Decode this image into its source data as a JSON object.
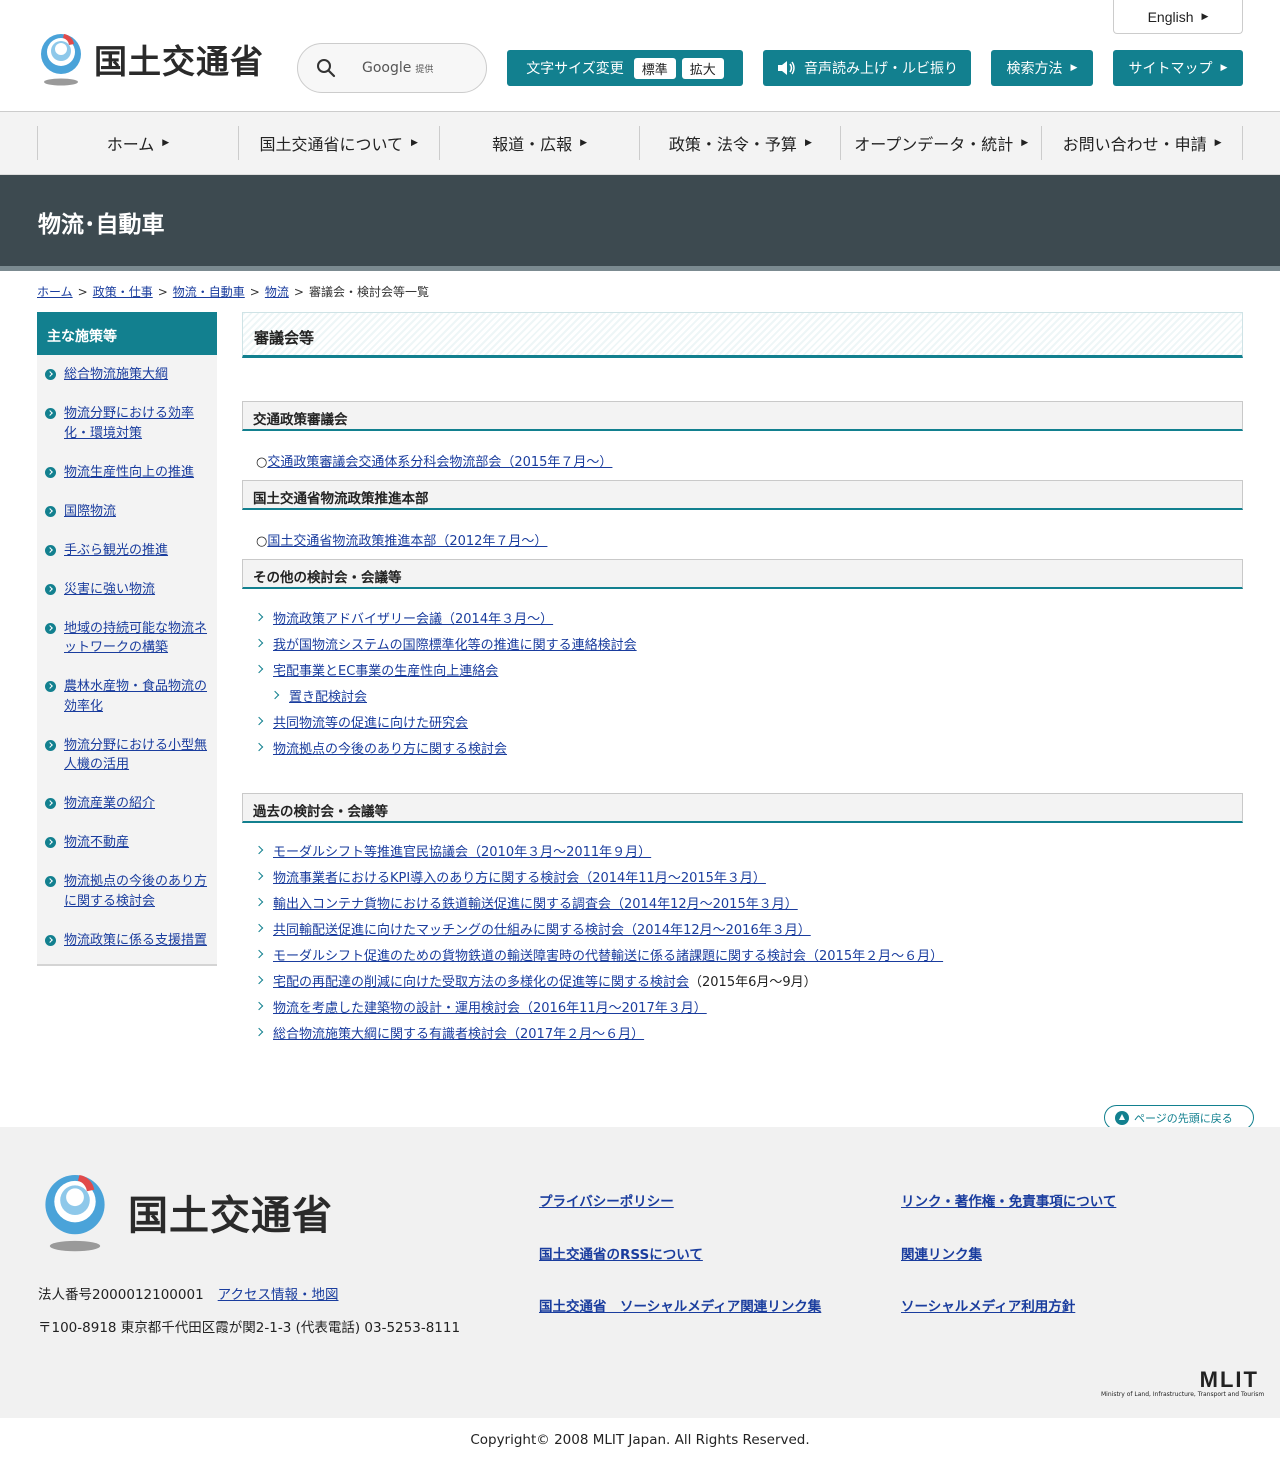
{
  "header": {
    "logo_text": "国土交通省",
    "search": {
      "provider": "Google",
      "provided_label": "提供"
    },
    "english_label": "English",
    "font_size": {
      "label": "文字サイズ変更",
      "standard": "標準",
      "large": "拡大"
    },
    "voice_label": "音声読み上げ・ルビ振り",
    "search_method_label": "検索方法",
    "sitemap_label": "サイトマップ"
  },
  "gnav": [
    "ホーム",
    "国土交通省について",
    "報道・広報",
    "政策・法令・予算",
    "オープンデータ・統計",
    "お問い合わせ・申請"
  ],
  "page_title": "物流･自動車",
  "breadcrumb": [
    "ホーム",
    "政策・仕事",
    "物流・自動車",
    "物流",
    "審議会・検討会等一覧"
  ],
  "sidebar": {
    "heading": "主な施策等",
    "items": [
      "総合物流施策大綱",
      "物流分野における効率化・環境対策",
      "物流生産性向上の推進",
      "国際物流",
      "手ぶら観光の推進",
      "災害に強い物流",
      "地域の持続可能な物流ネットワークの構築",
      "農林水産物・食品物流の効率化",
      "物流分野における小型無人機の活用",
      "物流産業の紹介",
      "物流不動産",
      "物流拠点の今後のあり方に関する検討会",
      "物流政策に係る支援措置"
    ]
  },
  "main": {
    "title": "審議会等",
    "sections": {
      "s1": {
        "heading": "交通政策審議会",
        "prefix": "○",
        "link": "交通政策審議会交通体系分科会物流部会（2015年７月～）"
      },
      "s2": {
        "heading": "国土交通省物流政策推進本部",
        "prefix": "○",
        "link": "国土交通省物流政策推進本部（2012年７月～）"
      },
      "s3": {
        "heading": "その他の検討会・会議等",
        "links": [
          "物流政策アドバイザリー会議（2014年３月～）",
          "我が国物流システムの国際標準化等の推進に関する連絡検討会",
          "宅配事業とEC事業の生産性向上連絡会",
          "置き配検討会",
          "共同物流等の促進に向けた研究会",
          "物流拠点の今後のあり方に関する検討会"
        ]
      },
      "s4": {
        "heading": "過去の検討会・会議等",
        "links": [
          "モーダルシフト等推進官民協議会（2010年３月～2011年９月）",
          "物流事業者におけるKPI導入のあり方に関する検討会（2014年11月～2015年３月）",
          "輸出入コンテナ貨物における鉄道輸送促進に関する調査会（2014年12月～2015年３月）",
          "共同輸配送促進に向けたマッチングの仕組みに関する検討会（2014年12月～2016年３月）",
          "モーダルシフト促進のための貨物鉄道の輸送障害時の代替輸送に係る諸課題に関する検討会（2015年２月～６月）",
          "宅配の再配達の削減に向けた受取方法の多様化の促進等に関する検討会",
          "物流を考慮した建築物の設計・運用検討会（2016年11月～2017年３月）",
          "総合物流施策大綱に関する有識者検討会（2017年２月～６月）"
        ],
        "suffix_6": "（2015年6月～9月）"
      }
    }
  },
  "pagetop_label": "ページの先頭に戻る",
  "footer": {
    "logo_text": "国土交通省",
    "corp_number": "法人番号2000012100001",
    "access_link": "アクセス情報・地図",
    "address": "〒100-8918 東京都千代田区霞が関2-1-3 (代表電話) 03-5253-8111",
    "links_col1": [
      "プライバシーポリシー",
      "国土交通省のRSSについて",
      "国土交通省　ソーシャルメディア関連リンク集"
    ],
    "links_col2": [
      "リンク・著作権・免責事項について",
      "関連リンク集",
      "ソーシャルメディア利用方針"
    ],
    "mlit": "MLIT",
    "mlit_full": "Ministry of Land, Infrastructure, Transport and Tourism"
  },
  "copyright": "Copyright© 2008 MLIT Japan. All Rights Reserved.",
  "colors": {
    "accent": "#12808f",
    "title_band": "#3d4a50",
    "link": "#1a3d9e"
  }
}
